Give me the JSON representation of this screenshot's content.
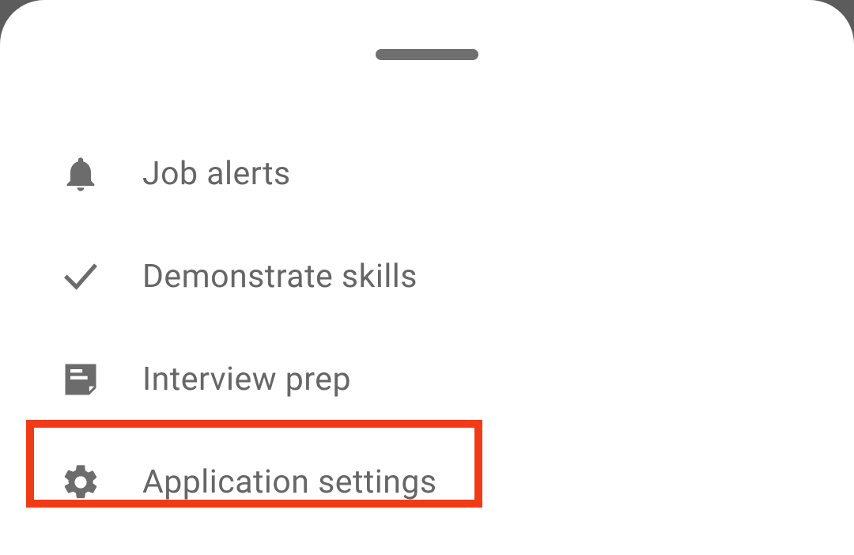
{
  "menu": {
    "items": [
      {
        "label": "Job alerts",
        "icon": "bell-icon"
      },
      {
        "label": "Demonstrate skills",
        "icon": "check-icon"
      },
      {
        "label": "Interview prep",
        "icon": "note-icon"
      },
      {
        "label": "Application settings",
        "icon": "gear-icon"
      }
    ]
  },
  "highlighted_index": 3
}
